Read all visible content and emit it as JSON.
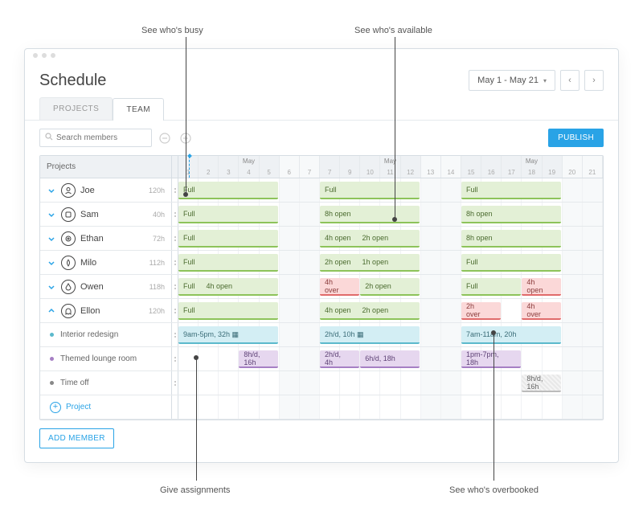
{
  "annotations": {
    "busy": "See who's busy",
    "available": "See who's available",
    "give_assignments": "Give assignments",
    "overbooked": "See who's overbooked"
  },
  "window_title": "Schedule",
  "date_range": "May 1 - May 21",
  "tabs": {
    "projects": "PROJECTS",
    "team": "TEAM"
  },
  "toolbar": {
    "search_placeholder": "Search members",
    "publish": "PUBLISH"
  },
  "grid_header_left": "Projects",
  "month_label": "May",
  "days": [
    {
      "n": "1"
    },
    {
      "n": "2"
    },
    {
      "n": "3"
    },
    {
      "n": "4"
    },
    {
      "n": "5"
    },
    {
      "n": "6",
      "w": true
    },
    {
      "n": "7",
      "w": true
    },
    {
      "n": "7"
    },
    {
      "n": "9"
    },
    {
      "n": "10"
    },
    {
      "n": "11"
    },
    {
      "n": "12"
    },
    {
      "n": "13",
      "w": true
    },
    {
      "n": "14",
      "w": true
    },
    {
      "n": "15"
    },
    {
      "n": "16"
    },
    {
      "n": "17"
    },
    {
      "n": "18"
    },
    {
      "n": "19"
    },
    {
      "n": "20",
      "w": true
    },
    {
      "n": "21",
      "w": true
    }
  ],
  "today_col": 1,
  "members": [
    {
      "name": "Joe",
      "hours": "120h",
      "avatar": "person",
      "expanded": false,
      "blocks": [
        {
          "start": 1,
          "span": 5,
          "cls": "green",
          "segs": [
            "Full"
          ]
        },
        {
          "start": 8,
          "span": 5,
          "cls": "green",
          "segs": [
            "Full"
          ]
        },
        {
          "start": 15,
          "span": 5,
          "cls": "green",
          "segs": [
            "Full"
          ]
        }
      ]
    },
    {
      "name": "Sam",
      "hours": "40h",
      "avatar": "square",
      "expanded": false,
      "blocks": [
        {
          "start": 1,
          "span": 5,
          "cls": "green",
          "segs": [
            "Full"
          ]
        },
        {
          "start": 8,
          "span": 5,
          "cls": "green",
          "segs": [
            "8h open"
          ]
        },
        {
          "start": 15,
          "span": 5,
          "cls": "green",
          "segs": [
            "8h open"
          ]
        }
      ]
    },
    {
      "name": "Ethan",
      "hours": "72h",
      "avatar": "ring",
      "expanded": false,
      "blocks": [
        {
          "start": 1,
          "span": 5,
          "cls": "green",
          "segs": [
            "Full"
          ]
        },
        {
          "start": 8,
          "span": 5,
          "cls": "green",
          "segs": [
            "4h open",
            "2h open"
          ]
        },
        {
          "start": 15,
          "span": 5,
          "cls": "green",
          "segs": [
            "8h open"
          ]
        }
      ]
    },
    {
      "name": "Milo",
      "hours": "112h",
      "avatar": "leaf",
      "expanded": false,
      "blocks": [
        {
          "start": 1,
          "span": 5,
          "cls": "green",
          "segs": [
            "Full"
          ]
        },
        {
          "start": 8,
          "span": 5,
          "cls": "green",
          "segs": [
            "2h open",
            "1h open"
          ]
        },
        {
          "start": 15,
          "span": 5,
          "cls": "green",
          "segs": [
            "Full"
          ]
        }
      ]
    },
    {
      "name": "Owen",
      "hours": "118h",
      "avatar": "drop",
      "expanded": false,
      "blocks": [
        {
          "start": 1,
          "span": 5,
          "cls": "green",
          "segs": [
            "Full",
            "4h open"
          ]
        },
        {
          "start": 8,
          "span": 2,
          "cls": "red",
          "segs": [
            "4h over"
          ]
        },
        {
          "start": 10,
          "span": 3,
          "cls": "green",
          "segs": [
            "2h open"
          ]
        },
        {
          "start": 15,
          "span": 3,
          "cls": "green",
          "segs": [
            "Full"
          ]
        },
        {
          "start": 18,
          "span": 2,
          "cls": "red",
          "segs": [
            "4h open"
          ]
        }
      ]
    },
    {
      "name": "Ellon",
      "hours": "120h",
      "avatar": "ghost",
      "expanded": true,
      "blocks": [
        {
          "start": 1,
          "span": 5,
          "cls": "green",
          "segs": [
            "Full"
          ]
        },
        {
          "start": 8,
          "span": 5,
          "cls": "green",
          "segs": [
            "4h open",
            "2h open"
          ]
        },
        {
          "start": 15,
          "span": 2,
          "cls": "red",
          "segs": [
            "2h over"
          ]
        },
        {
          "start": 18,
          "span": 2,
          "cls": "red",
          "segs": [
            "4h over"
          ]
        }
      ]
    }
  ],
  "subrows": [
    {
      "label": "Interior redesign",
      "bullet": "#5bb9cc",
      "blocks": [
        {
          "start": 1,
          "span": 5,
          "cls": "cyan",
          "segs": [
            "9am-5pm, 32h ▦"
          ]
        },
        {
          "start": 8,
          "span": 5,
          "cls": "cyan",
          "segs": [
            "2h/d, 10h ▦"
          ]
        },
        {
          "start": 15,
          "span": 5,
          "cls": "cyan",
          "segs": [
            "7am-11am, 20h"
          ]
        }
      ]
    },
    {
      "label": "Themed lounge room",
      "bullet": "#a67fc4",
      "blocks": [
        {
          "start": 4,
          "span": 2,
          "cls": "purple",
          "segs": [
            "8h/d, 16h"
          ]
        },
        {
          "start": 8,
          "span": 2,
          "cls": "purple",
          "segs": [
            "2h/d, 4h"
          ]
        },
        {
          "start": 10,
          "span": 3,
          "cls": "purple",
          "segs": [
            "6h/d, 18h"
          ]
        },
        {
          "start": 15,
          "span": 3,
          "cls": "purple",
          "segs": [
            "1pm-7pm, 18h"
          ]
        }
      ]
    },
    {
      "label": "Time off",
      "bullet": "#888",
      "blocks": [
        {
          "start": 18,
          "span": 2,
          "cls": "grey",
          "segs": [
            "8h/d, 16h"
          ]
        }
      ]
    }
  ],
  "add_project_label": "Project",
  "add_member_label": "ADD MEMBER"
}
